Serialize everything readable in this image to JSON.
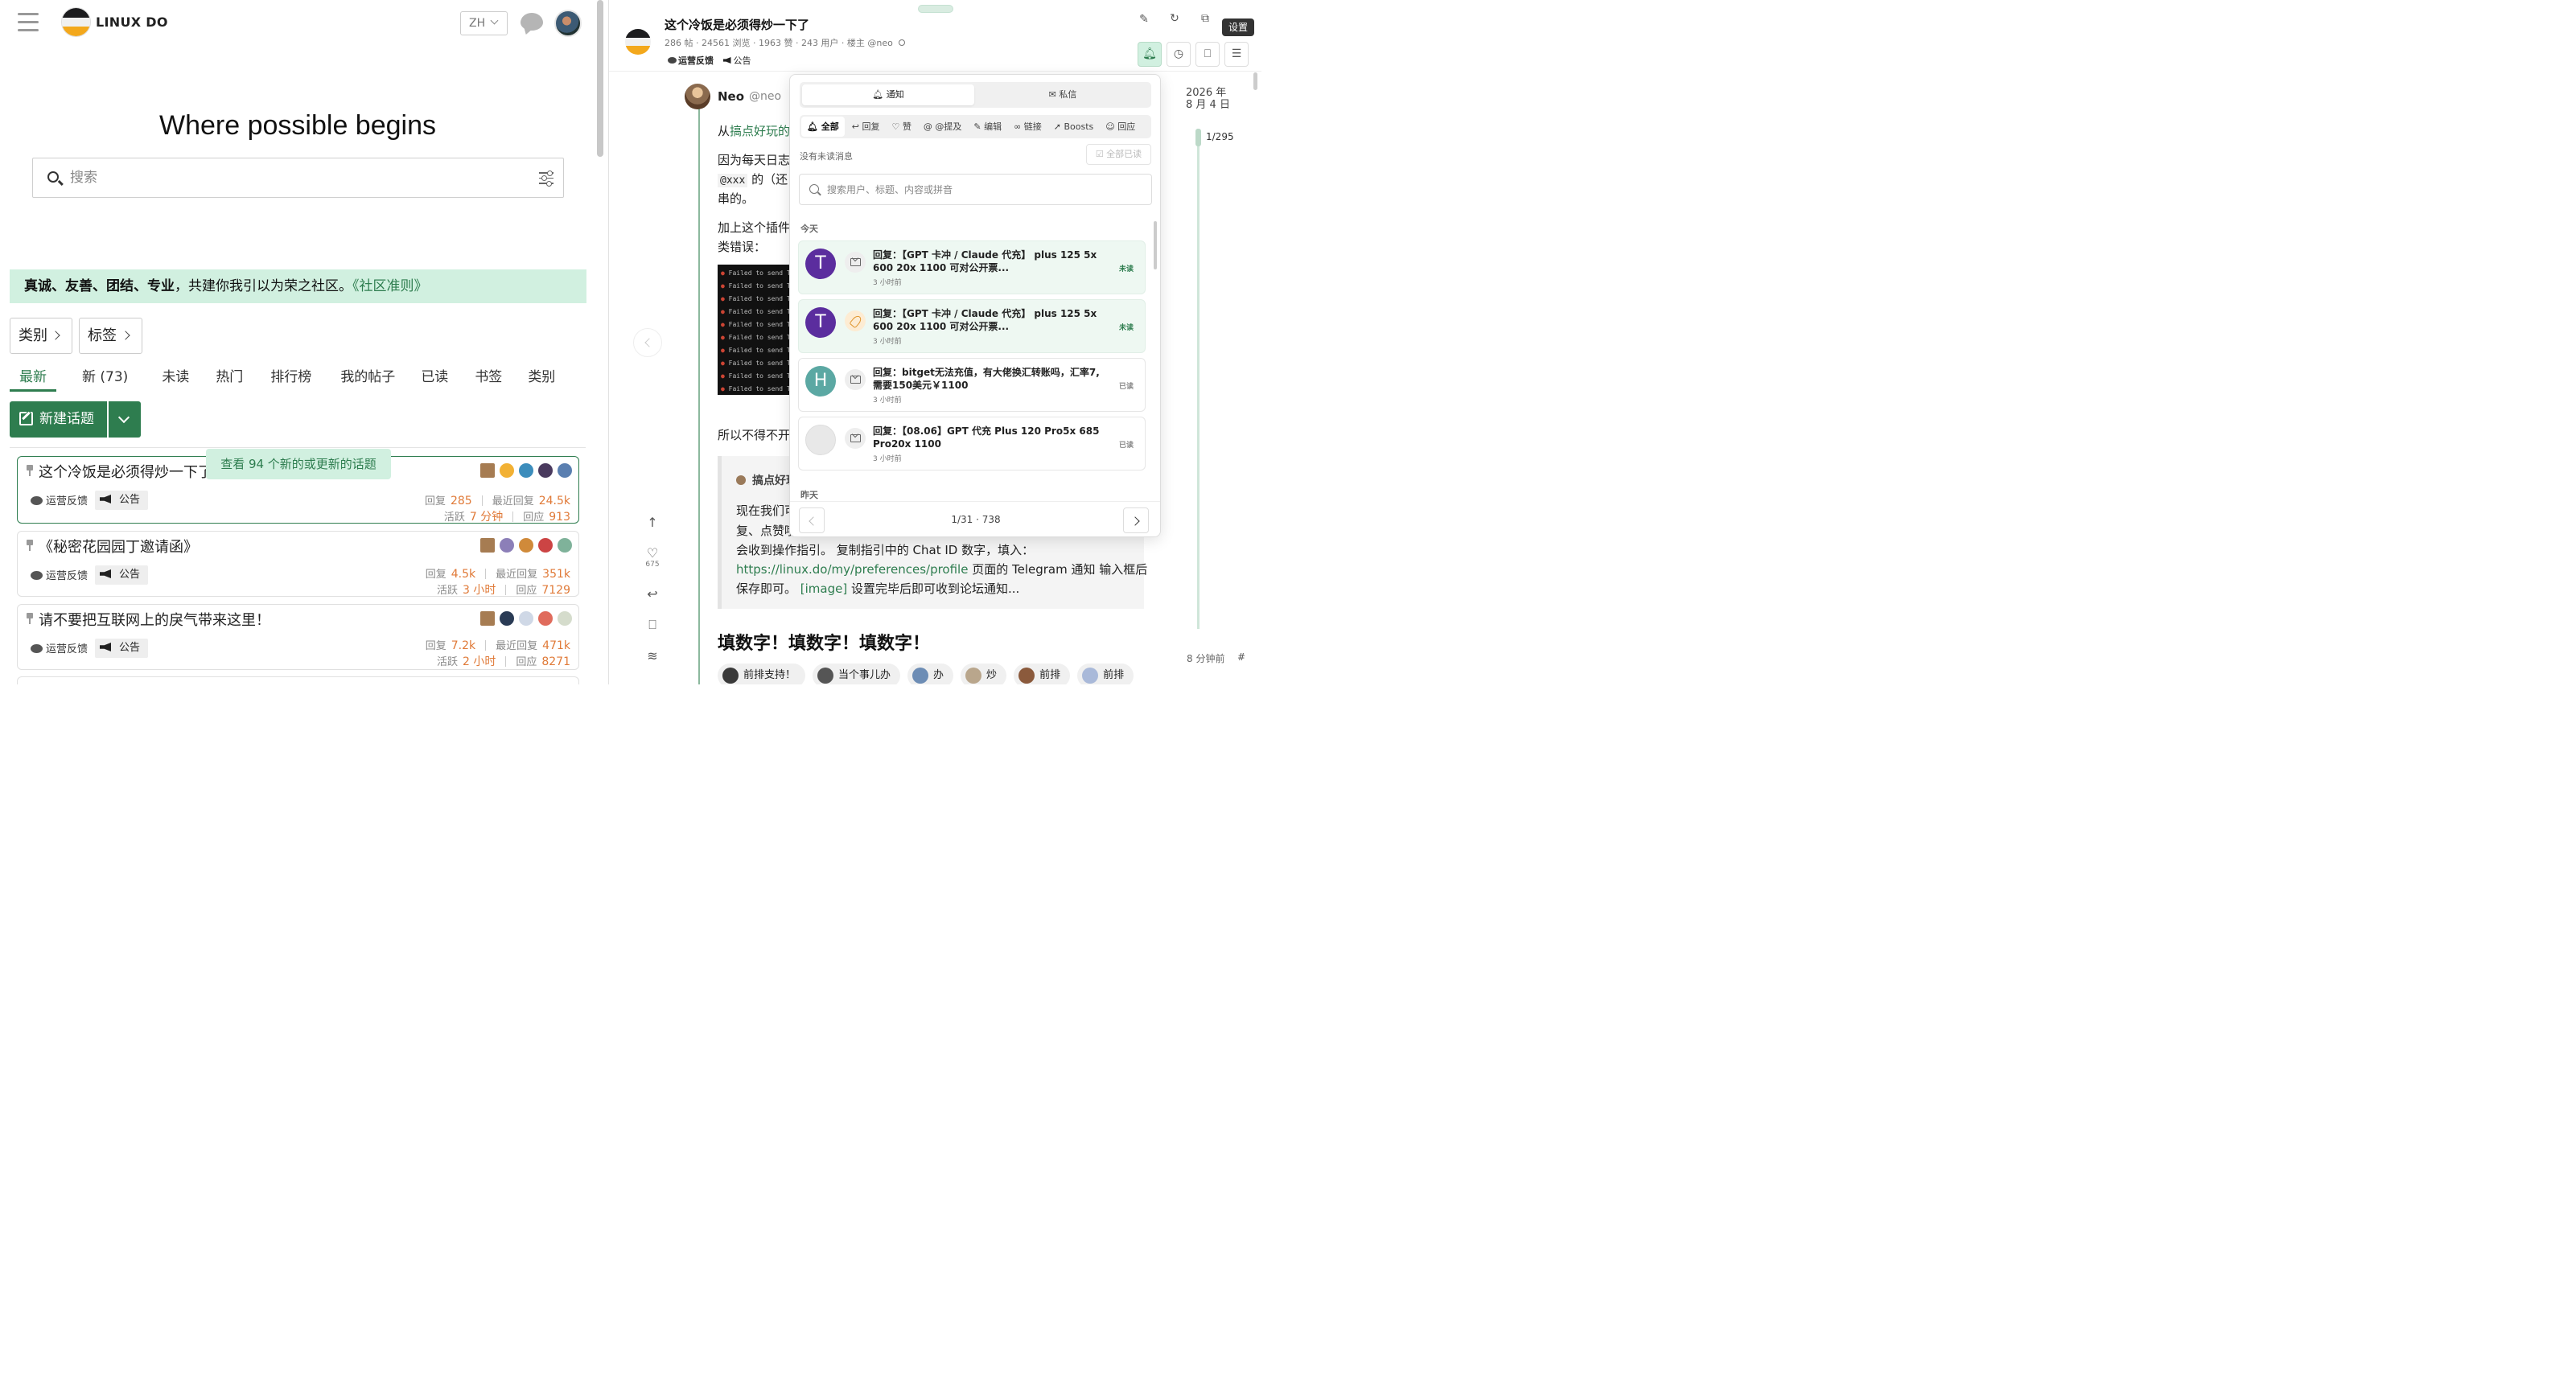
{
  "site": {
    "title": "LINUX DO",
    "language": "ZH"
  },
  "hero": {
    "heading": "Where possible begins",
    "search_placeholder": "搜索"
  },
  "banner": {
    "bold_text": "真诚、友善、团结、专业",
    "text": "，共建你我引以为荣之社区。",
    "link": "《社区准则》"
  },
  "filters": {
    "categories": "类别",
    "tags": "标签"
  },
  "nav_tabs": [
    "最新",
    "新 (73)",
    "未读",
    "热门",
    "排行榜",
    "我的帖子",
    "已读",
    "书签",
    "类别"
  ],
  "new_topic_label": "新建话题",
  "new_topics_pill": "查看 94 个新的或更新的话题",
  "topics": [
    {
      "title": "这个冷饭是必须得炒一下了",
      "category": "运营反馈",
      "tag": "公告",
      "replies_label": "回复",
      "replies": "285",
      "last_reply_label": "最近回复",
      "last_reply": "24.5k",
      "active_label": "活跃",
      "active": "7 分钟",
      "response_label": "回应",
      "responses": "913"
    },
    {
      "title": "《秘密花园园丁邀请函》",
      "category": "运营反馈",
      "tag": "公告",
      "replies_label": "回复",
      "replies": "4.5k",
      "last_reply_label": "最近回复",
      "last_reply": "351k",
      "active_label": "活跃",
      "active": "3 小时",
      "response_label": "回应",
      "responses": "7129"
    },
    {
      "title": "请不要把互联网上的戾气带来这里！",
      "category": "运营反馈",
      "tag": "公告",
      "replies_label": "回复",
      "replies": "7.2k",
      "last_reply_label": "最近回复",
      "last_reply": "471k",
      "active_label": "活跃",
      "active": "2 小时",
      "response_label": "回应",
      "responses": "8271"
    }
  ],
  "right": {
    "title": "这个冷饭是必须得炒一下了",
    "meta": "286 帖 · 24561 浏览 · 1963 赞 · 243 用户 · 楼主 @neo",
    "category": "运营反馈",
    "tag": "公告",
    "tooltip": "设置",
    "post": {
      "author": "Neo",
      "handle": "@neo",
      "line1_prefix": "从",
      "line1_link": "搞点好玩的",
      "line2": "因为每天日志",
      "line3_code": "@xxx",
      "line3_rest": " 的（还",
      "line4": "串的。",
      "line5": "加上这个插件",
      "line6": "类错误：",
      "terminal_lines": [
        "Failed to send Tele",
        "Failed to send Tele",
        "Failed to send Tele",
        "Failed to send Tele",
        "Failed to send Tele",
        "Failed to send Tele",
        "Failed to send Tele",
        "Failed to send Tele",
        "Failed to send Tele",
        "Failed to send Tele"
      ],
      "line7": "所以不得不开",
      "quote_title": "搞点好玩",
      "quote_l1": "现在我们可",
      "quote_l2": "复、点赞哦",
      "quote_l3": "会收到操作指引。 复制指引中的 Chat ID 数字，填入：",
      "quote_link": "https://linux.do/my/preferences/profile",
      "quote_l4_rest": " 页面的 Telegram 通知 输入框后",
      "quote_l5a": "保存即可。 ",
      "quote_l5_img": "[image]",
      "quote_l5b": " 设置完毕后即可收到论坛通知...",
      "heading": "填数字！填数字！填数字！",
      "reactions": [
        "前排支持！",
        "当个事儿办",
        "办",
        "炒",
        "前排",
        "前排"
      ]
    },
    "side_likes": "675",
    "timeline": {
      "date_line1": "2026 年",
      "date_line2": "8 月 4 日",
      "progress": "1/295",
      "ago": "8 分钟前",
      "hash": "#"
    }
  },
  "notifications": {
    "tab_notify": "通知",
    "tab_pm": "私信",
    "filters": [
      "全部",
      "回复",
      "赞",
      "@提及",
      "编辑",
      "链接",
      "Boosts",
      "回应"
    ],
    "no_unread": "没有未读消息",
    "mark_all_read": "全部已读",
    "search_placeholder": "搜索用户、标题、内容或拼音",
    "today": "今天",
    "yesterday": "昨天",
    "items": [
      {
        "avatar": "T",
        "color": "#5b2d9e",
        "text": "回复：【GPT 卡冲 / Claude 代充】 plus 125 5x 600 20x 1100 可对公开票...",
        "time": "3 小时前",
        "status": "未读"
      },
      {
        "avatar": "T",
        "color": "#5b2d9e",
        "text": "回复：【GPT 卡冲 / Claude 代充】 plus 125 5x 600 20x 1100 可对公开票...",
        "time": "3 小时前",
        "status": "未读"
      },
      {
        "avatar": "H",
        "color": "#5ba8a3",
        "text": "回复：bitget无法充值，有大佬换汇转账吗，汇率7, 需要150美元￥1100",
        "time": "3 小时前",
        "status": "已读"
      },
      {
        "avatar": "",
        "color": "#e8e8e8",
        "text": "回复：【08.06】GPT 代充 Plus 120 Pro5x 685 Pro20x 1100",
        "time": "3 小时前",
        "status": "已读"
      }
    ],
    "pagination": "1/31 · 738"
  }
}
